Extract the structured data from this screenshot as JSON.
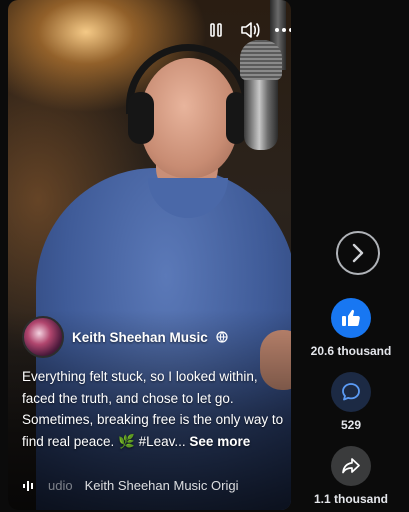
{
  "video": {
    "author": "Keith Sheehan Music",
    "caption": "Everything felt stuck, so I looked within, faced the truth, and chose to let go. Sometimes, breaking free is the only way to find real peace. 🌿 #Leav...",
    "see_more": "See more",
    "audio_prefix": "udio",
    "audio_track": "Keith Sheehan Music Origi"
  },
  "actions": {
    "likes": "20.6 thousand",
    "comments": "529",
    "shares": "1.1 thousand"
  },
  "icons": {
    "pause": "pause-icon",
    "volume": "volume-icon",
    "more": "more-icon",
    "globe": "globe-icon",
    "audio": "audio-icon",
    "next": "chevron-right-icon",
    "like": "thumbs-up-icon",
    "comment": "comment-icon",
    "share": "share-icon"
  },
  "colors": {
    "like_blue": "#1877f2",
    "button_gray": "#3a3b3c",
    "background": "#0b0b0b"
  }
}
